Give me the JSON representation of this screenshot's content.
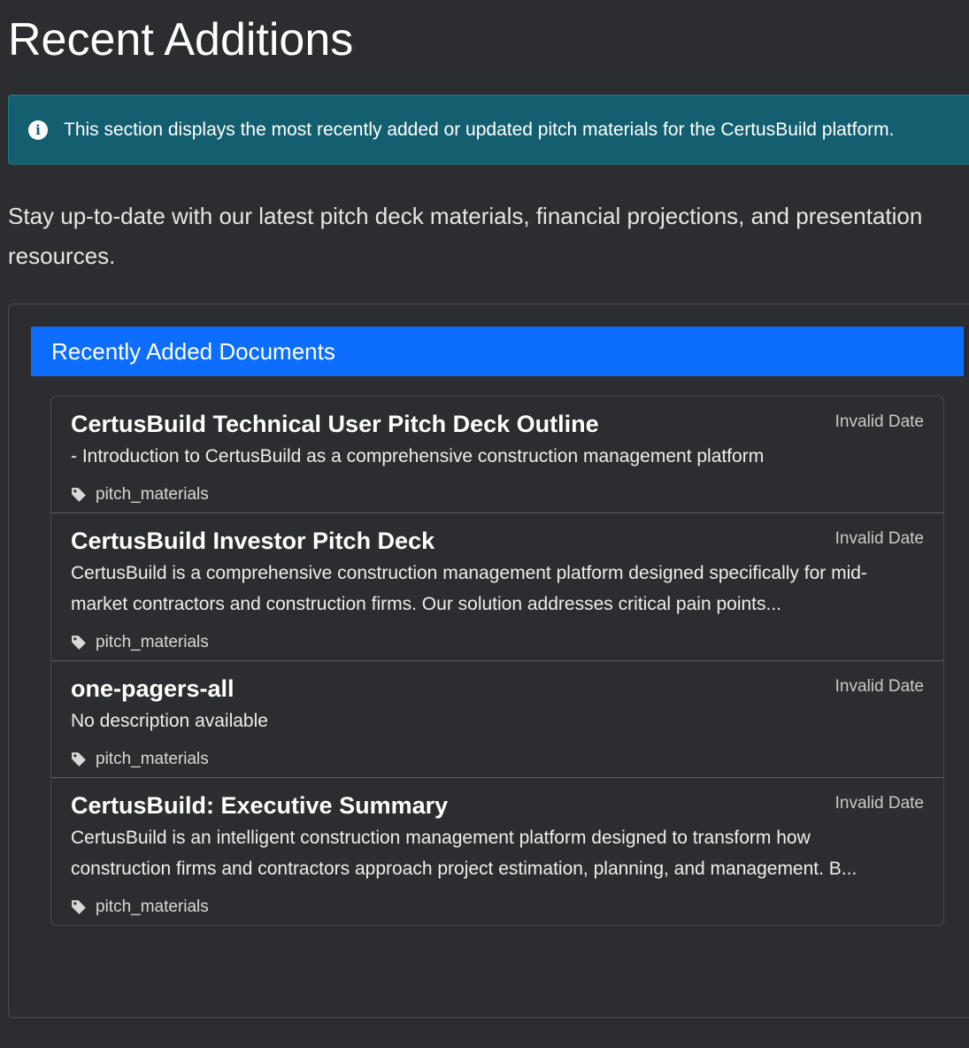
{
  "page": {
    "title": "Recent Additions",
    "alert": {
      "icon": "info-icon",
      "text": "This section displays the most recently added or updated pitch materials for the CertusBuild platform."
    },
    "lead": "Stay up-to-date with our latest pitch deck materials, financial projections, and presentation resources."
  },
  "card": {
    "header": "Recently Added Documents",
    "items": [
      {
        "title": "CertusBuild Technical User Pitch Deck Outline",
        "date": "Invalid Date",
        "description": "- Introduction to CertusBuild as a comprehensive construction management platform",
        "tag": "pitch_materials"
      },
      {
        "title": "CertusBuild Investor Pitch Deck",
        "date": "Invalid Date",
        "description": "CertusBuild is a comprehensive construction management platform designed specifically for mid-market contractors and construction firms. Our solution addresses critical pain points...",
        "tag": "pitch_materials"
      },
      {
        "title": "one-pagers-all",
        "date": "Invalid Date",
        "description": "No description available",
        "tag": "pitch_materials"
      },
      {
        "title": "CertusBuild: Executive Summary",
        "date": "Invalid Date",
        "description": "CertusBuild is an intelligent construction management platform designed to transform how construction firms and contractors approach project estimation, planning, and management. B...",
        "tag": "pitch_materials"
      }
    ]
  },
  "colors": {
    "background": "#2b2d30",
    "alert_bg": "#145f6f",
    "header_bg": "#0d6efd"
  }
}
